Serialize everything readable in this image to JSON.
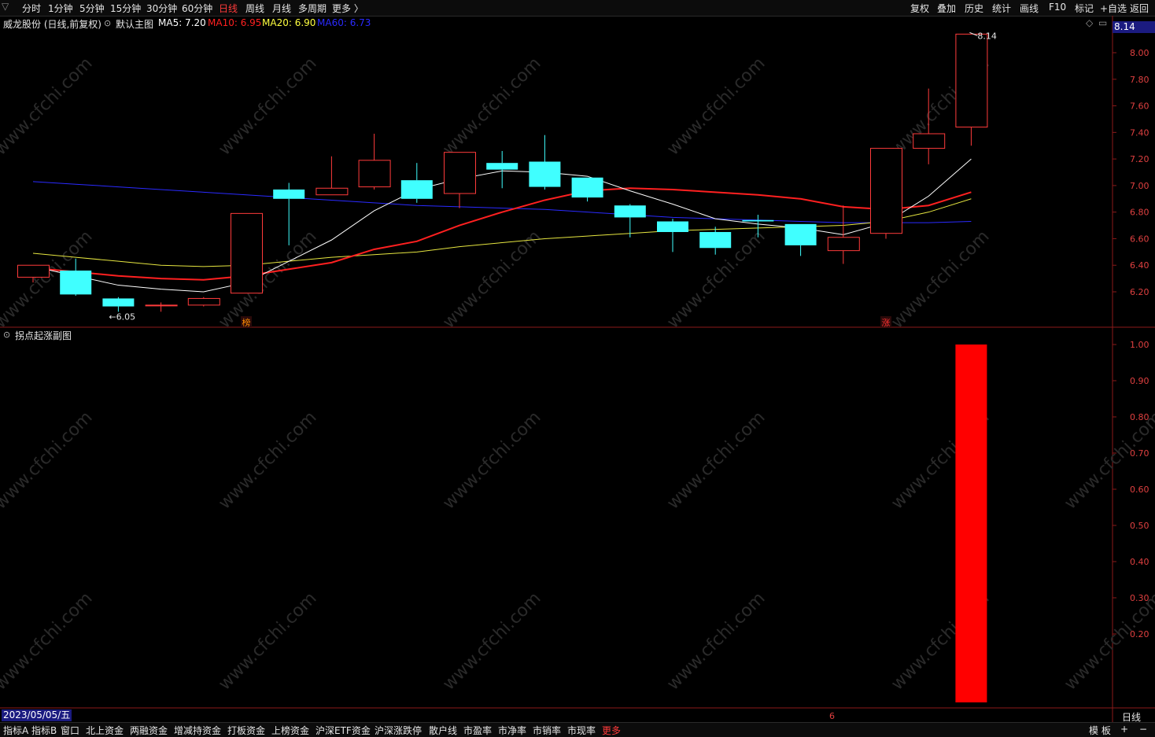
{
  "toolbar": {
    "periods": [
      "分时",
      "1分钟",
      "5分钟",
      "15分钟",
      "30分钟",
      "60分钟",
      "日线",
      "周线",
      "月线",
      "多周期",
      "更多 〉"
    ],
    "active_period": "日线",
    "right_buttons": [
      "复权",
      "叠加",
      "历史",
      "统计",
      "画线",
      "F10",
      "标记",
      "+自选",
      "返回"
    ]
  },
  "info": {
    "stock": "威龙股份 (日线,前复权)",
    "template": "默认主图",
    "ma5": "MA5: 7.20",
    "ma10": "MA10: 6.95",
    "ma20": "MA20: 6.90",
    "ma60": "MA60: 6.73",
    "colors": {
      "ma5": "#ffffff",
      "ma10": "#ff2020",
      "ma20": "#ffff40",
      "ma60": "#2020ff"
    }
  },
  "price_axis": {
    "current_price": "8.14",
    "ticks": [
      "8.00",
      "7.80",
      "7.60",
      "7.40",
      "7.20",
      "7.00",
      "6.80",
      "6.60",
      "6.40",
      "6.20"
    ]
  },
  "sub_chart": {
    "title": "拐点起涨副图",
    "ticks": [
      "1.00",
      "0.90",
      "0.80",
      "0.70",
      "0.60",
      "0.50",
      "0.40",
      "0.30",
      "0.20"
    ]
  },
  "chart_data": {
    "type": "candlestick",
    "ylim": [
      6.0,
      8.2
    ],
    "candles": [
      {
        "o": 6.31,
        "h": 6.36,
        "l": 6.27,
        "c": 6.4
      },
      {
        "o": 6.36,
        "h": 6.45,
        "l": 6.17,
        "c": 6.18
      },
      {
        "o": 6.15,
        "h": 6.16,
        "l": 6.05,
        "c": 6.09
      },
      {
        "o": 6.1,
        "h": 6.12,
        "l": 6.05,
        "c": 6.1
      },
      {
        "o": 6.1,
        "h": 6.16,
        "l": 6.09,
        "c": 6.15
      },
      {
        "o": 6.19,
        "h": 6.79,
        "l": 6.19,
        "c": 6.79
      },
      {
        "o": 6.97,
        "h": 7.02,
        "l": 6.55,
        "c": 6.9
      },
      {
        "o": 6.93,
        "h": 7.22,
        "l": 6.93,
        "c": 6.98
      },
      {
        "o": 6.99,
        "h": 7.39,
        "l": 6.97,
        "c": 7.19
      },
      {
        "o": 7.04,
        "h": 7.17,
        "l": 6.87,
        "c": 6.9
      },
      {
        "o": 6.94,
        "h": 7.25,
        "l": 6.83,
        "c": 7.25
      },
      {
        "o": 7.17,
        "h": 7.26,
        "l": 6.98,
        "c": 7.12
      },
      {
        "o": 7.18,
        "h": 7.38,
        "l": 6.97,
        "c": 6.99
      },
      {
        "o": 7.06,
        "h": 7.06,
        "l": 6.88,
        "c": 6.91
      },
      {
        "o": 6.85,
        "h": 6.86,
        "l": 6.61,
        "c": 6.76
      },
      {
        "o": 6.73,
        "h": 6.75,
        "l": 6.5,
        "c": 6.65
      },
      {
        "o": 6.65,
        "h": 6.69,
        "l": 6.48,
        "c": 6.53
      },
      {
        "o": 6.74,
        "h": 6.78,
        "l": 6.61,
        "c": 6.73
      },
      {
        "o": 6.71,
        "h": 6.71,
        "l": 6.47,
        "c": 6.55
      },
      {
        "o": 6.51,
        "h": 6.85,
        "l": 6.41,
        "c": 6.61
      },
      {
        "o": 6.64,
        "h": 7.28,
        "l": 6.6,
        "c": 7.28
      },
      {
        "o": 7.28,
        "h": 7.73,
        "l": 7.16,
        "c": 7.39
      },
      {
        "o": 7.44,
        "h": 8.14,
        "l": 7.3,
        "c": 8.14
      }
    ],
    "ma5": [
      6.39,
      6.32,
      6.25,
      6.22,
      6.2,
      6.27,
      6.43,
      6.59,
      6.81,
      6.97,
      7.05,
      7.11,
      7.1,
      7.07,
      6.96,
      6.86,
      6.75,
      6.71,
      6.68,
      6.63,
      6.72,
      6.92,
      7.2
    ],
    "ma10": [
      6.38,
      6.35,
      6.32,
      6.3,
      6.29,
      6.32,
      6.37,
      6.42,
      6.52,
      6.58,
      6.7,
      6.8,
      6.89,
      6.96,
      6.98,
      6.97,
      6.95,
      6.93,
      6.9,
      6.84,
      6.82,
      6.85,
      6.95
    ],
    "ma20": [
      6.49,
      6.46,
      6.43,
      6.4,
      6.39,
      6.4,
      6.43,
      6.46,
      6.48,
      6.5,
      6.54,
      6.57,
      6.6,
      6.62,
      6.64,
      6.66,
      6.67,
      6.68,
      6.69,
      6.7,
      6.73,
      6.8,
      6.9
    ],
    "ma60": [
      7.03,
      7.01,
      6.99,
      6.97,
      6.95,
      6.93,
      6.91,
      6.89,
      6.87,
      6.85,
      6.84,
      6.83,
      6.82,
      6.8,
      6.78,
      6.76,
      6.75,
      6.74,
      6.73,
      6.72,
      6.72,
      6.72,
      6.73
    ],
    "annotations": [
      {
        "index": 2,
        "price": 6.05,
        "text": "6.05"
      },
      {
        "index": 22,
        "price": 8.14,
        "text": "8.14"
      }
    ],
    "markers": [
      {
        "index": 5,
        "text": "榜",
        "color": "#ff8c00"
      },
      {
        "index": 20,
        "text": "涨",
        "color": "#ff3030"
      }
    ],
    "sub_values": [
      0,
      0,
      0,
      0,
      0,
      0,
      0,
      0,
      0,
      0,
      0,
      0,
      0,
      0,
      0,
      0,
      0,
      0,
      0,
      0,
      0,
      0,
      1
    ],
    "sub_ylim": [
      0,
      1.0
    ]
  },
  "status": {
    "date": "2023/05/05/五",
    "month_marker": "6",
    "period": "日线"
  },
  "bottom_tabs": [
    "指标A",
    "指标B",
    "窗口",
    "北上资金",
    "两融资金",
    "增减持资金",
    "打板资金",
    "上榜资金",
    "沪深ETF资金",
    "沪深涨跌停",
    "散户线",
    "市盈率",
    "市净率",
    "市销率",
    "市现率",
    "更多"
  ],
  "bottom_right": [
    "模 板",
    "+",
    "−"
  ],
  "watermark": "www.cfchi.com"
}
